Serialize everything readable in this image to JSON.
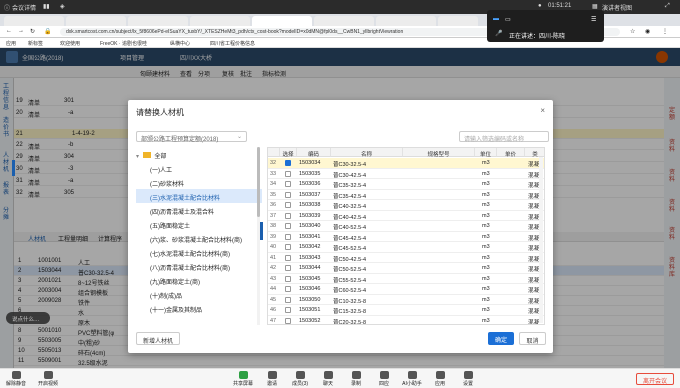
{
  "meeting": {
    "top_left": "会议详情",
    "time": "01:51:21",
    "view_mode": "演讲者视图",
    "presenter_label": "正在讲述：四川-陈晓",
    "chat_bubble": "说点什么…",
    "bottom_items": [
      "解除静音",
      "开启视频",
      "共享屏幕",
      "邀请",
      "成员(3)",
      "聊天",
      "录制",
      "四应",
      "AI小助手",
      "应用",
      "设置"
    ],
    "end_button": "离开会议"
  },
  "browser": {
    "tabs": [
      "",
      "",
      "",
      "",
      "",
      "",
      "",
      "",
      "",
      ""
    ],
    "url": "dxk.smartcost.com.cn/subject/lx_5f8606ePd-eISuaYX_tuxbY/_XTESZHeMt3_pdh/ctx_cost-book?modelID=x0dMN@fpl0ds__CwBN1_yllbrightViewration",
    "bookmarks": [
      "应用",
      "新标签",
      "欢迎使用",
      "FreeOK · 追剧也很哇",
      "纵横中心",
      "四川省工程价格信息"
    ]
  },
  "app": {
    "title": "全国公路(2018)",
    "nav": [
      "项目管理",
      "四川XX大桥"
    ],
    "toolbar": [
      "匈颐建材料",
      "查看",
      "分项",
      "复核",
      "批注",
      "指标检测"
    ]
  },
  "left_panel_labels": [
    "工程信息",
    "造价书",
    "人材机",
    "报表",
    "分摊"
  ],
  "right_panel_labels": [
    "定额",
    "资料",
    "资料",
    "资料",
    "资料",
    "资料库"
  ],
  "background_rows": [
    [
      "19",
      "清单",
      "301"
    ],
    [
      "20",
      "清单",
      "-a"
    ],
    [
      "21",
      "",
      "1-4-19-2"
    ],
    [
      "22",
      "清单",
      "-b"
    ],
    [
      "29",
      "清单",
      "304"
    ],
    [
      "30",
      "清单",
      "-3"
    ],
    [
      "31",
      "清单",
      "-a"
    ],
    [
      "32",
      "清单",
      "305"
    ]
  ],
  "background_bottom_rows": [
    [
      "1",
      "1001001",
      "人工"
    ],
    [
      "2",
      "1503044",
      "普C30-32.5-4"
    ],
    [
      "3",
      "2001021",
      "8~12号铁丝"
    ],
    [
      "4",
      "2003004",
      "组合钢模板"
    ],
    [
      "5",
      "2009028",
      "铁件"
    ],
    [
      "6",
      "",
      "水"
    ],
    [
      "7",
      "",
      "原木"
    ],
    [
      "8",
      "5001010",
      "PVC塑料管(φ"
    ],
    [
      "9",
      "5503005",
      "中(粗)砂"
    ],
    [
      "10",
      "5505013",
      "碎石(4cm)"
    ],
    [
      "11",
      "5509001",
      "32.5级水泥"
    ]
  ],
  "background_tabs": [
    "人材机",
    "工程量明细",
    "计算程序"
  ],
  "dialog": {
    "title": "请替换人材机",
    "close": "×",
    "select_value": "部颁公路工程预算定额(2018)",
    "search_placeholder": "请输入筛选编码或名称",
    "tree": [
      {
        "label": "全部",
        "indent": 0,
        "selected": false
      },
      {
        "label": "(一)人工",
        "indent": 1,
        "selected": false
      },
      {
        "label": "(二)砂浆材料",
        "indent": 1,
        "selected": false
      },
      {
        "label": "(三)水泥混凝土配合比材料",
        "indent": 1,
        "selected": true
      },
      {
        "label": "(四)沥青混凝土及混合料",
        "indent": 1,
        "selected": false
      },
      {
        "label": "(五)路面稳定土",
        "indent": 1,
        "selected": false
      },
      {
        "label": "(六)浆、砂浆混凝土配合比材料(商)",
        "indent": 1,
        "selected": false
      },
      {
        "label": "(七)水泥混凝土配合比材料(商)",
        "indent": 1,
        "selected": false
      },
      {
        "label": "(八)沥青混凝土配合比材料(商)",
        "indent": 1,
        "selected": false
      },
      {
        "label": "(九)路面稳定土(商)",
        "indent": 1,
        "selected": false
      },
      {
        "label": "(十)制(成)品",
        "indent": 1,
        "selected": false
      },
      {
        "label": "(十一)金属及其制品",
        "indent": 1,
        "selected": false
      }
    ],
    "columns": [
      "",
      "选择",
      "编码",
      "名称",
      "规格型号",
      "单位",
      "单价",
      "类"
    ],
    "rows": [
      {
        "no": "32",
        "checked": true,
        "code": "1503034",
        "name": "普C30-32.5-4",
        "spec": "",
        "unit": "m3",
        "price": "",
        "type": "混凝"
      },
      {
        "no": "33",
        "checked": false,
        "code": "1503035",
        "name": "普C30-42.5-4",
        "spec": "",
        "unit": "m3",
        "price": "",
        "type": "混凝"
      },
      {
        "no": "34",
        "checked": false,
        "code": "1503036",
        "name": "普C35-32.5-4",
        "spec": "",
        "unit": "m3",
        "price": "",
        "type": "混凝"
      },
      {
        "no": "35",
        "checked": false,
        "code": "1503037",
        "name": "普C35-42.5-4",
        "spec": "",
        "unit": "m3",
        "price": "",
        "type": "混凝"
      },
      {
        "no": "36",
        "checked": false,
        "code": "1503038",
        "name": "普C40-32.5-4",
        "spec": "",
        "unit": "m3",
        "price": "",
        "type": "混凝"
      },
      {
        "no": "37",
        "checked": false,
        "code": "1503039",
        "name": "普C40-42.5-4",
        "spec": "",
        "unit": "m3",
        "price": "",
        "type": "混凝"
      },
      {
        "no": "38",
        "checked": false,
        "code": "1503040",
        "name": "普C40-52.5-4",
        "spec": "",
        "unit": "m3",
        "price": "",
        "type": "混凝"
      },
      {
        "no": "39",
        "checked": false,
        "code": "1503041",
        "name": "普C45-42.5-4",
        "spec": "",
        "unit": "m3",
        "price": "",
        "type": "混凝"
      },
      {
        "no": "40",
        "checked": false,
        "code": "1503042",
        "name": "普C45-52.5-4",
        "spec": "",
        "unit": "m3",
        "price": "",
        "type": "混凝"
      },
      {
        "no": "41",
        "checked": false,
        "code": "1503043",
        "name": "普C50-42.5-4",
        "spec": "",
        "unit": "m3",
        "price": "",
        "type": "混凝"
      },
      {
        "no": "42",
        "checked": false,
        "code": "1503044",
        "name": "普C50-52.5-4",
        "spec": "",
        "unit": "m3",
        "price": "",
        "type": "混凝"
      },
      {
        "no": "43",
        "checked": false,
        "code": "1503045",
        "name": "普C55-52.5-4",
        "spec": "",
        "unit": "m3",
        "price": "",
        "type": "混凝"
      },
      {
        "no": "44",
        "checked": false,
        "code": "1503046",
        "name": "普C60-52.5-4",
        "spec": "",
        "unit": "m3",
        "price": "",
        "type": "混凝"
      },
      {
        "no": "45",
        "checked": false,
        "code": "1503050",
        "name": "普C10-32.5-8",
        "spec": "",
        "unit": "m3",
        "price": "",
        "type": "混凝"
      },
      {
        "no": "46",
        "checked": false,
        "code": "1503051",
        "name": "普C15-32.5-8",
        "spec": "",
        "unit": "m3",
        "price": "",
        "type": "混凝"
      },
      {
        "no": "47",
        "checked": false,
        "code": "1503052",
        "name": "普C20-32.5-8",
        "spec": "",
        "unit": "m3",
        "price": "",
        "type": "混凝"
      }
    ],
    "new_button": "新增人材机",
    "ok_button": "确定",
    "cancel_button": "取消"
  },
  "accent_color": "#1b6fd6"
}
